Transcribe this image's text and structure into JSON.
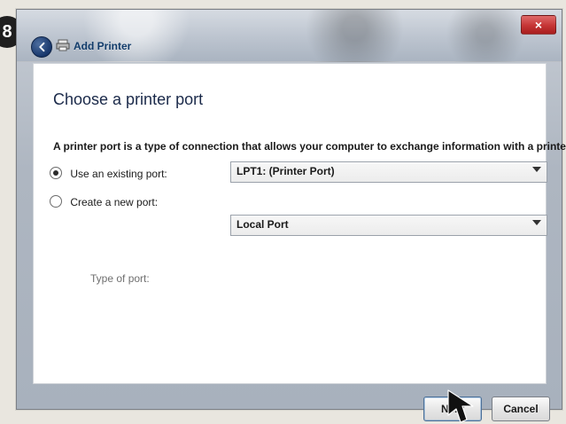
{
  "badge": {
    "text": "8"
  },
  "window": {
    "title": "Add Printer",
    "close_label": "×"
  },
  "content": {
    "heading": "Choose a printer port",
    "description": "A printer port is a type of connection that allows your computer to exchange information with a printer.",
    "options": [
      {
        "label": "Use an existing port:",
        "selected": true
      },
      {
        "label": "Create a new port:",
        "selected": false
      }
    ],
    "existing_port": {
      "value": "LPT1: (Printer Port)"
    },
    "new_port": {
      "type_label": "Type of port:",
      "value": "Local Port"
    }
  },
  "buttons": {
    "next": "Next",
    "cancel": "Cancel"
  },
  "icons": {
    "back": "back-arrow-icon",
    "printer": "printer-icon",
    "dropdown": "chevron-down-icon",
    "pointer": "mouse-pointer-icon"
  }
}
